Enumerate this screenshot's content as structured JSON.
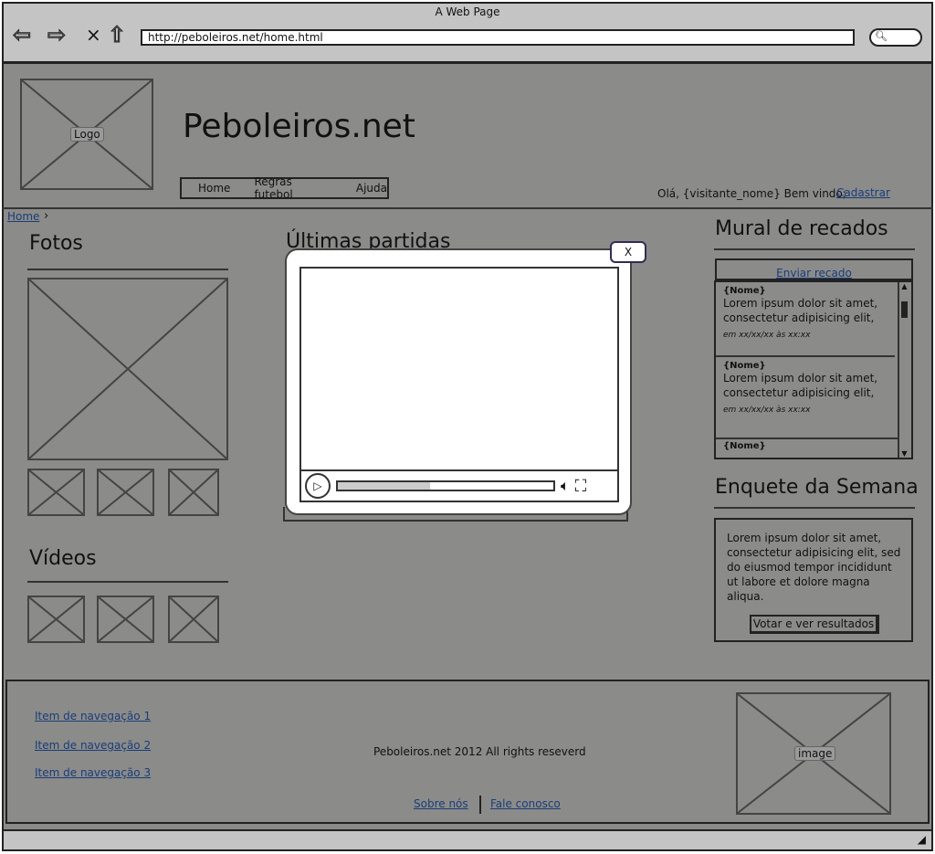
{
  "browser": {
    "title": "A Web Page",
    "url": "http://peboleiros.net/home.html"
  },
  "header": {
    "logo_label": "Logo",
    "site_title": "Peboleiros.net",
    "menu": [
      "Home",
      "Regras futebol",
      "Ajuda"
    ],
    "greeting": "Olá, {visitante_nome} Bem vindo;",
    "register_link": "Cadastrar"
  },
  "breadcrumb": {
    "home": "Home",
    "sep": "›"
  },
  "fotos": {
    "title": "Fotos"
  },
  "videos": {
    "title": "Vídeos"
  },
  "partidas": {
    "title": "Últimas partidas"
  },
  "mural": {
    "title": "Mural de recados",
    "send": "Enviar recado",
    "messages": [
      {
        "name": "{Nome}",
        "text": "Lorem ipsum dolor sit amet, consectetur adipisicing elit,",
        "date": "em xx/xx/xx às xx:xx"
      },
      {
        "name": "{Nome}",
        "text": "Lorem ipsum dolor sit amet, consectetur adipisicing elit,",
        "date": "em xx/xx/xx às xx:xx"
      },
      {
        "name": "{Nome}"
      }
    ]
  },
  "enquete": {
    "title": "Enquete da Semana",
    "text": "Lorem ipsum dolor sit amet, consectetur adipisicing elit, sed do eiusmod tempor incididunt ut labore et dolore magna aliqua.",
    "button": "Votar e ver resultados"
  },
  "footer": {
    "nav": [
      "Item de navegação 1",
      "Item de navegação 2",
      "Item de navegação 3"
    ],
    "copyright": "Peboleiros.net 2012 All rights reseverd",
    "about": "Sobre nós",
    "contact": "Fale conosco",
    "image_label": "image"
  },
  "modal": {
    "close": "X",
    "progress": 0.43
  }
}
